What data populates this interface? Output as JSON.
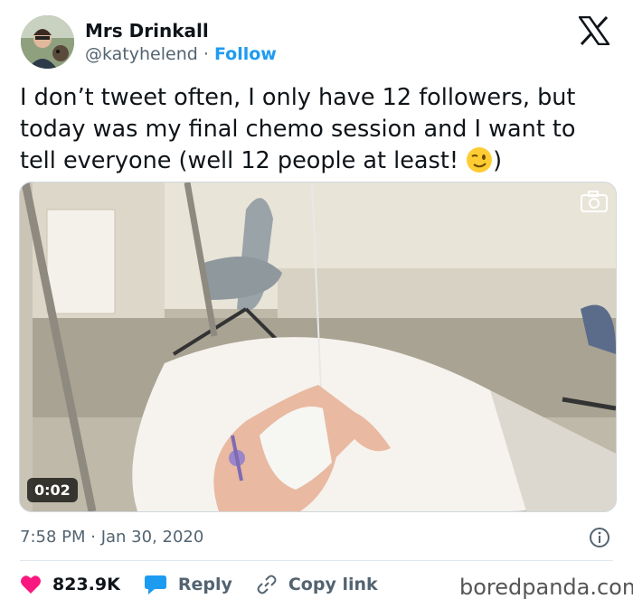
{
  "author": {
    "name": "Mrs Drinkall",
    "handle": "@katyhelend",
    "separator": "·",
    "follow_label": "Follow"
  },
  "tweet": {
    "text": "I don’t tweet often, I only have 12 followers, but today was my final chemo session and I want to tell everyone (well 12 people at least! ",
    "text_end": ")",
    "emoji": "winking-face",
    "timestamp": "7:58 PM · Jan 30, 2020"
  },
  "media": {
    "type": "video",
    "duration": "0:02"
  },
  "actions": {
    "likes": "823.9K",
    "reply_label": "Reply",
    "copy_label": "Copy link"
  },
  "watermark": "boredpanda.com",
  "colors": {
    "link": "#1d9bf0",
    "heart": "#f91880",
    "secondary_text": "#536471"
  },
  "icons": [
    "x-logo-icon",
    "camera-icon",
    "info-icon",
    "heart-icon",
    "reply-bubble-icon",
    "link-icon"
  ]
}
